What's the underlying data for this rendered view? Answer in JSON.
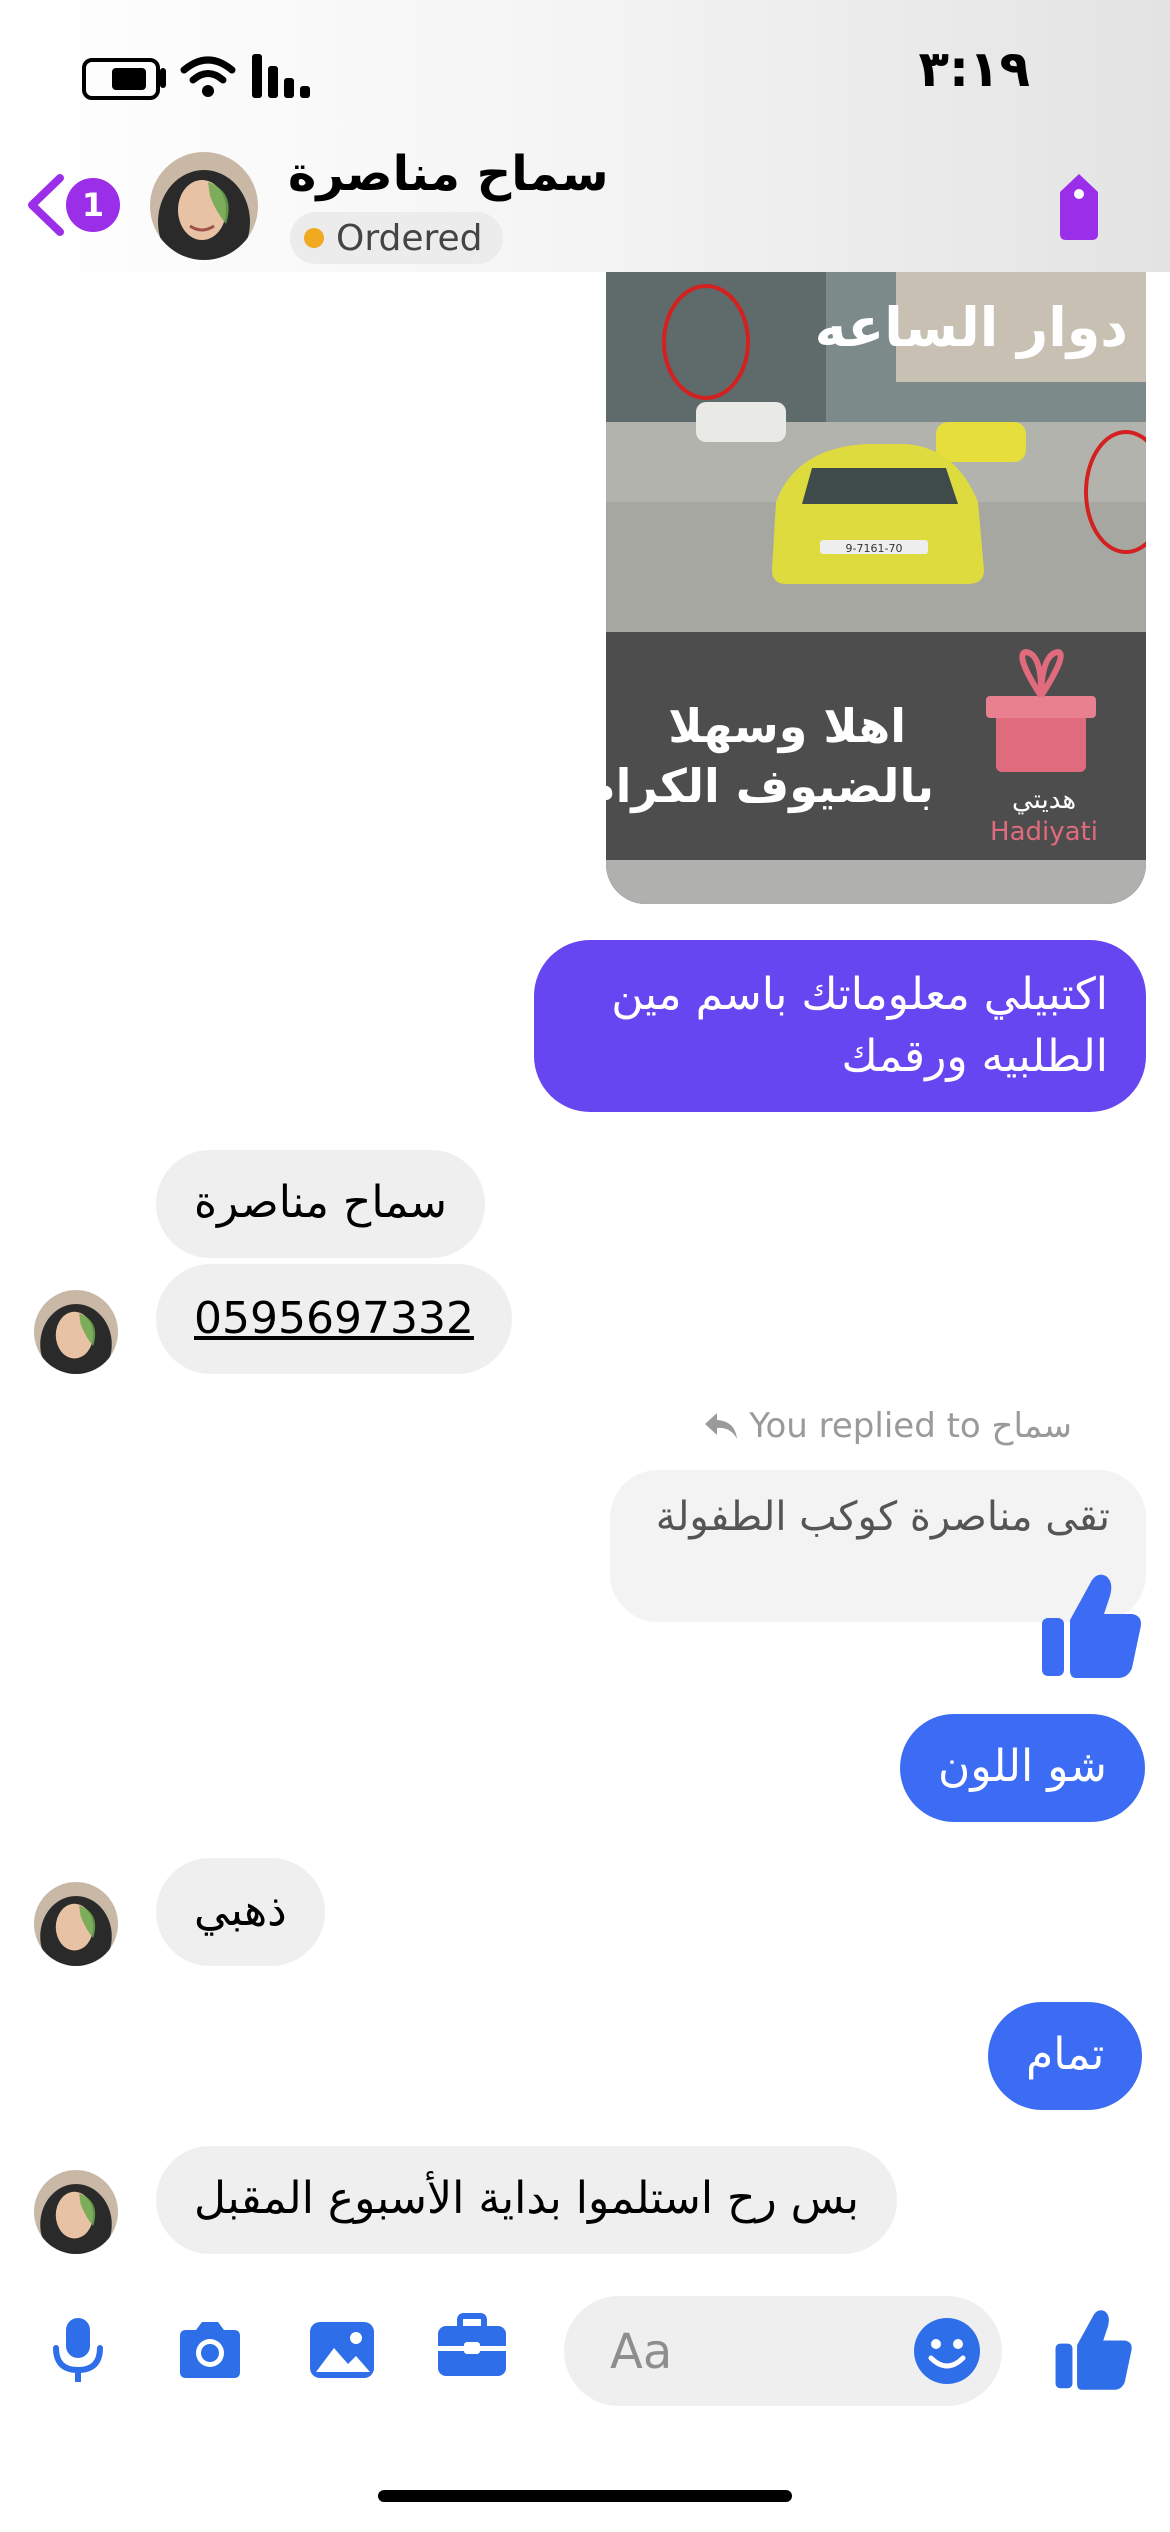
{
  "status": {
    "time": "٣:١٩"
  },
  "header": {
    "name": "سماح مناصرة",
    "status_label": "Ordered",
    "unread_count": "1"
  },
  "image_message": {
    "place_caption": "دوار الساعه",
    "welcome_line1": "اهلا وسهلا",
    "welcome_line2": "بالضيوف الكرام",
    "shop_name_ar": "هديتي",
    "shop_name_en": "Hadiyati",
    "plate_text": "9-7161-70"
  },
  "messages": {
    "m1": "اكتبيلي معلوماتك باسم مين الطلبيه ورقمك",
    "m2": "سماح مناصرة",
    "m3": "0595697332",
    "reply_label": "You replied to سماح",
    "quoted": "تقى مناصرة كوكب الطفولة",
    "m4": "شو اللون",
    "m5": "ذهبي",
    "m6": "تمام",
    "m7": "بس رح استلموا بداية الأسبوع المقبل"
  },
  "composer": {
    "placeholder": "Aa"
  },
  "colors": {
    "accent_purple": "#9b2ee8",
    "bubble_purple": "#6546f1",
    "bubble_blue": "#3d6cf4",
    "icon_blue": "#2e6ee8"
  }
}
